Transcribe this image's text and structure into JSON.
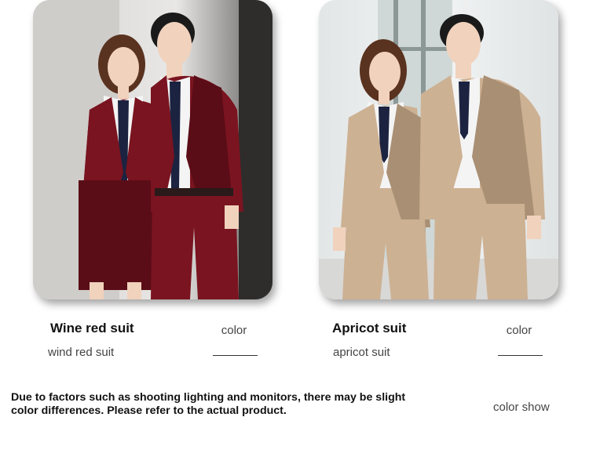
{
  "products": [
    {
      "title": "Wine red suit",
      "subtitle": "wind red suit",
      "color_label": "color",
      "suit_color": "#7a1420",
      "suit_shadow": "#5a0d17"
    },
    {
      "title": "Apricot suit",
      "subtitle": "apricot suit",
      "color_label": "color",
      "suit_color": "#cdb193",
      "suit_shadow": "#a98f74"
    }
  ],
  "disclaimer": "Due to factors such as shooting lighting and monitors, there may be slight color differences. Please refer to the actual product.",
  "color_show_label": "color show",
  "colors": {
    "tie": "#1c2340",
    "shirt": "#f4f4f4",
    "skin": "#f1d2bd",
    "hair_woman": "#5a3220",
    "hair_man": "#1a1a1a"
  }
}
